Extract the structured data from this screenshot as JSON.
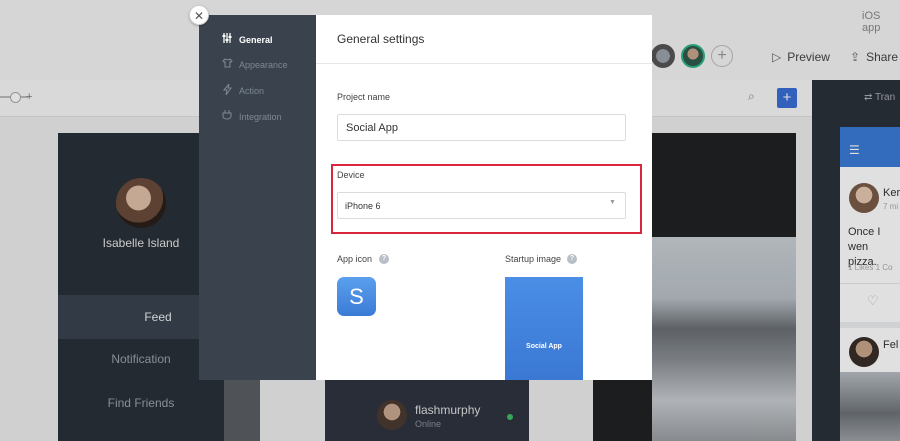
{
  "app": {
    "platform_label": "iOS app",
    "toolbar": {
      "preview_label": "Preview",
      "share_label": "Share"
    },
    "transitions_label": "Tran"
  },
  "background": {
    "screen1": {
      "user_name": "Isabelle Island",
      "menu": [
        "Feed",
        "Notification",
        "Find Friends"
      ]
    },
    "screen2": {
      "user_name": "flashmurphy",
      "status": "Online"
    },
    "screen4": {
      "name_1": "Ker",
      "time_1": "7 mi",
      "post_text_line1": "Once I wen",
      "post_text_line2": "pizza.",
      "likes": "1 Likes  1 Co",
      "name_2": "Fel"
    }
  },
  "modal": {
    "close_icon": "close-icon",
    "sidebar": {
      "items": [
        {
          "label": "General",
          "icon": "sliders-icon",
          "active": true
        },
        {
          "label": "Appearance",
          "icon": "shirt-icon",
          "active": false
        },
        {
          "label": "Action",
          "icon": "lightning-icon",
          "active": false
        },
        {
          "label": "Integration",
          "icon": "plug-icon",
          "active": false
        }
      ]
    },
    "title": "General settings",
    "project_name": {
      "label": "Project name",
      "value": "Social App"
    },
    "device": {
      "label": "Device",
      "selected": "iPhone 6"
    },
    "app_icon": {
      "label": "App icon",
      "letter": "S"
    },
    "startup_image": {
      "label": "Startup image",
      "text": "Social App"
    },
    "help_glyph": "?"
  },
  "colors": {
    "accent_blue": "#3b7bd6",
    "highlight_red": "#d9263f",
    "sidebar_bg": "#3a434d",
    "online_green": "#3fbf5f"
  }
}
